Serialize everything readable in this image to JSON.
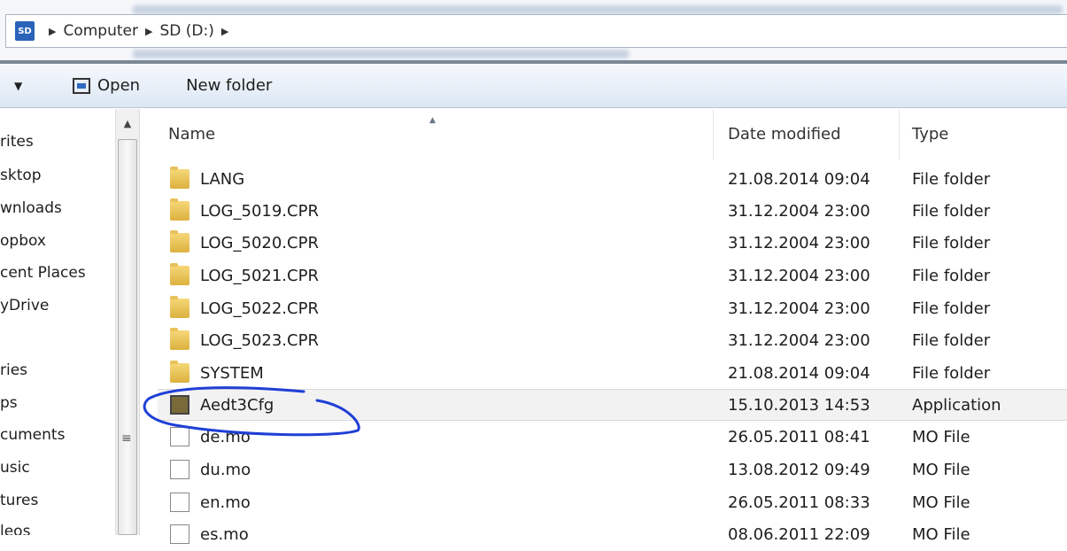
{
  "address": {
    "drive_badge": "SD",
    "crumbs": [
      "Computer",
      "SD (D:)"
    ]
  },
  "toolbar": {
    "open_label": "Open",
    "new_folder_label": "New folder"
  },
  "nav": {
    "items": [
      "rites",
      "sktop",
      "wnloads",
      "opbox",
      "cent Places",
      "yDrive",
      "ries",
      "ps",
      "cuments",
      "usic",
      "tures",
      "leos"
    ]
  },
  "columns": {
    "name": "Name",
    "date": "Date modified",
    "type": "Type"
  },
  "files": [
    {
      "name": "LANG",
      "date": "21.08.2014 09:04",
      "type": "File folder",
      "icon": "folder-icon"
    },
    {
      "name": "LOG_5019.CPR",
      "date": "31.12.2004 23:00",
      "type": "File folder",
      "icon": "folder-icon"
    },
    {
      "name": "LOG_5020.CPR",
      "date": "31.12.2004 23:00",
      "type": "File folder",
      "icon": "folder-icon"
    },
    {
      "name": "LOG_5021.CPR",
      "date": "31.12.2004 23:00",
      "type": "File folder",
      "icon": "folder-icon"
    },
    {
      "name": "LOG_5022.CPR",
      "date": "31.12.2004 23:00",
      "type": "File folder",
      "icon": "folder-icon"
    },
    {
      "name": "LOG_5023.CPR",
      "date": "31.12.2004 23:00",
      "type": "File folder",
      "icon": "folder-icon"
    },
    {
      "name": "SYSTEM",
      "date": "21.08.2014 09:04",
      "type": "File folder",
      "icon": "folder-icon"
    },
    {
      "name": "Aedt3Cfg",
      "date": "15.10.2013 14:53",
      "type": "Application",
      "icon": "application-icon",
      "selected": true
    },
    {
      "name": "de.mo",
      "date": "26.05.2011 08:41",
      "type": "MO File",
      "icon": "file-icon"
    },
    {
      "name": "du.mo",
      "date": "13.08.2012 09:49",
      "type": "MO File",
      "icon": "file-icon"
    },
    {
      "name": "en.mo",
      "date": "26.05.2011 08:33",
      "type": "MO File",
      "icon": "file-icon"
    },
    {
      "name": "es.mo",
      "date": "08.06.2011 22:09",
      "type": "MO File",
      "icon": "file-icon"
    }
  ],
  "annotation_color": "#1f3fd6"
}
